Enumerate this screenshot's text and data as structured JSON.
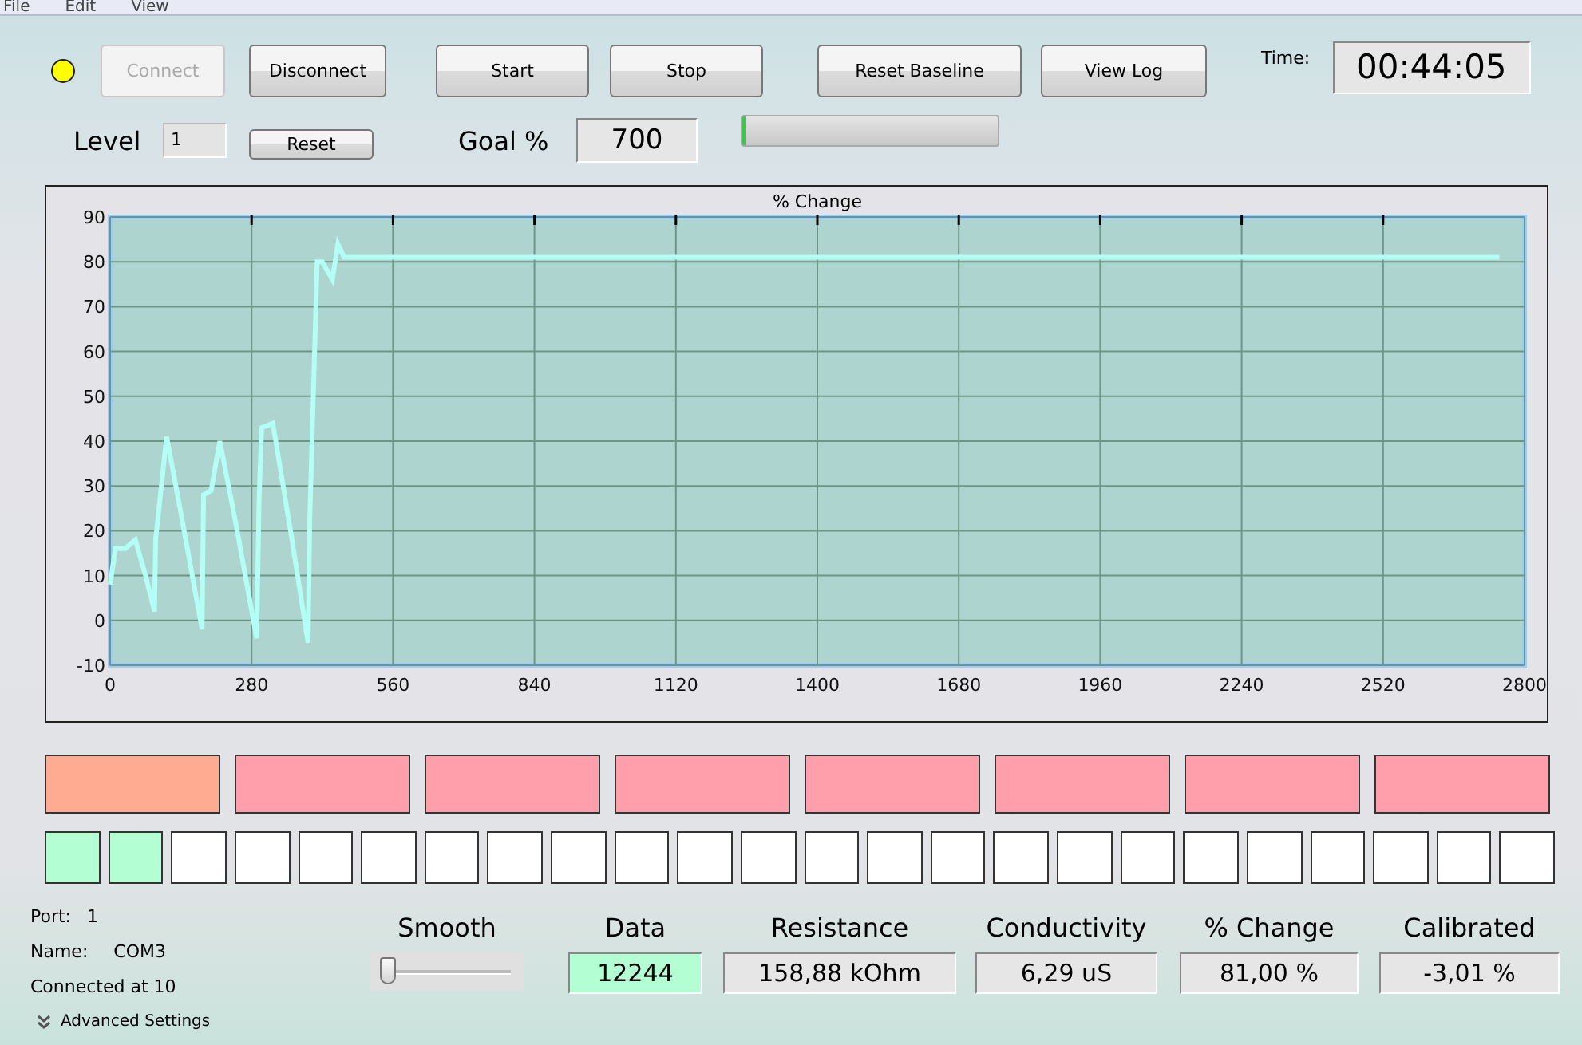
{
  "menu": [
    "File",
    "Edit",
    "View"
  ],
  "status_light": {
    "color": "#ffff00"
  },
  "buttons": [
    {
      "label": "Connect",
      "disabled": true
    },
    {
      "label": "Disconnect",
      "disabled": false
    },
    {
      "label": "Start",
      "disabled": false
    },
    {
      "label": "Stop",
      "disabled": false
    },
    {
      "label": "Reset Baseline",
      "disabled": false
    },
    {
      "label": "View Log",
      "disabled": false
    }
  ],
  "time": {
    "label": "Time:",
    "value": "00:44:05"
  },
  "level": {
    "label": "Level",
    "value": "1",
    "reset": "Reset"
  },
  "goal": {
    "label": "Goal %",
    "value": "700"
  },
  "progress": {
    "level": 0.01
  },
  "chart": {
    "chart_data": {
      "type": "line",
      "title": "% Change",
      "x": [
        0,
        10,
        30,
        50,
        70,
        88,
        90,
        112,
        140,
        182,
        185,
        200,
        217,
        250,
        290,
        295,
        300,
        322,
        360,
        392,
        395,
        410,
        420,
        440,
        451,
        463,
        2750
      ],
      "values": [
        8,
        16,
        16,
        18,
        10,
        2,
        18,
        41,
        24,
        -2,
        28,
        29,
        40,
        21,
        -4,
        27,
        43,
        44,
        18,
        -5,
        22,
        80,
        80,
        76,
        84,
        81,
        81
      ],
      "grid": true,
      "xlim": [
        0,
        2800
      ],
      "ylim": [
        -10,
        90
      ],
      "xticks": [
        0,
        280,
        560,
        840,
        1120,
        1400,
        1680,
        1960,
        2240,
        2520,
        2800
      ],
      "yticks": [
        -10,
        0,
        10,
        20,
        30,
        40,
        50,
        60,
        70,
        80,
        90
      ]
    }
  },
  "blocks": [
    {
      "color": "#ffab91"
    },
    {
      "color": "#ff9fab"
    },
    {
      "color": "#ff9fab"
    },
    {
      "color": "#ff9fab"
    },
    {
      "color": "#ff9fab"
    },
    {
      "color": "#ff9fab"
    },
    {
      "color": "#ff9fab"
    },
    {
      "color": "#ff9fab"
    }
  ],
  "cells": [
    {
      "color": "#b3ffd3"
    },
    {
      "color": "#b3ffd3"
    },
    {
      "color": "#ffffff"
    },
    {
      "color": "#ffffff"
    },
    {
      "color": "#ffffff"
    },
    {
      "color": "#ffffff"
    },
    {
      "color": "#ffffff"
    },
    {
      "color": "#ffffff"
    },
    {
      "color": "#ffffff"
    },
    {
      "color": "#ffffff"
    },
    {
      "color": "#ffffff"
    },
    {
      "color": "#ffffff"
    },
    {
      "color": "#ffffff"
    },
    {
      "color": "#ffffff"
    },
    {
      "color": "#ffffff"
    },
    {
      "color": "#ffffff"
    },
    {
      "color": "#ffffff"
    },
    {
      "color": "#ffffff"
    },
    {
      "color": "#ffffff"
    },
    {
      "color": "#ffffff"
    },
    {
      "color": "#ffffff"
    },
    {
      "color": "#ffffff"
    },
    {
      "color": "#ffffff"
    },
    {
      "color": "#ffffff"
    }
  ],
  "connection": {
    "port_label": "Port:",
    "port": "1",
    "name_label": "Name:",
    "name": "COM3",
    "status": "Connected at 10",
    "advanced": "Advanced Settings"
  },
  "smooth": {
    "label": "Smooth",
    "level": 0
  },
  "readouts": [
    {
      "label": "Data",
      "value": "12244",
      "highlight": true
    },
    {
      "label": "Resistance",
      "value": "158,88 kOhm",
      "highlight": false
    },
    {
      "label": "Conductivity",
      "value": "6,29 uS",
      "highlight": false
    },
    {
      "label": "% Change",
      "value": "81,00 %",
      "highlight": false
    },
    {
      "label": "Calibrated",
      "value": "-3,01 %",
      "highlight": false
    }
  ]
}
